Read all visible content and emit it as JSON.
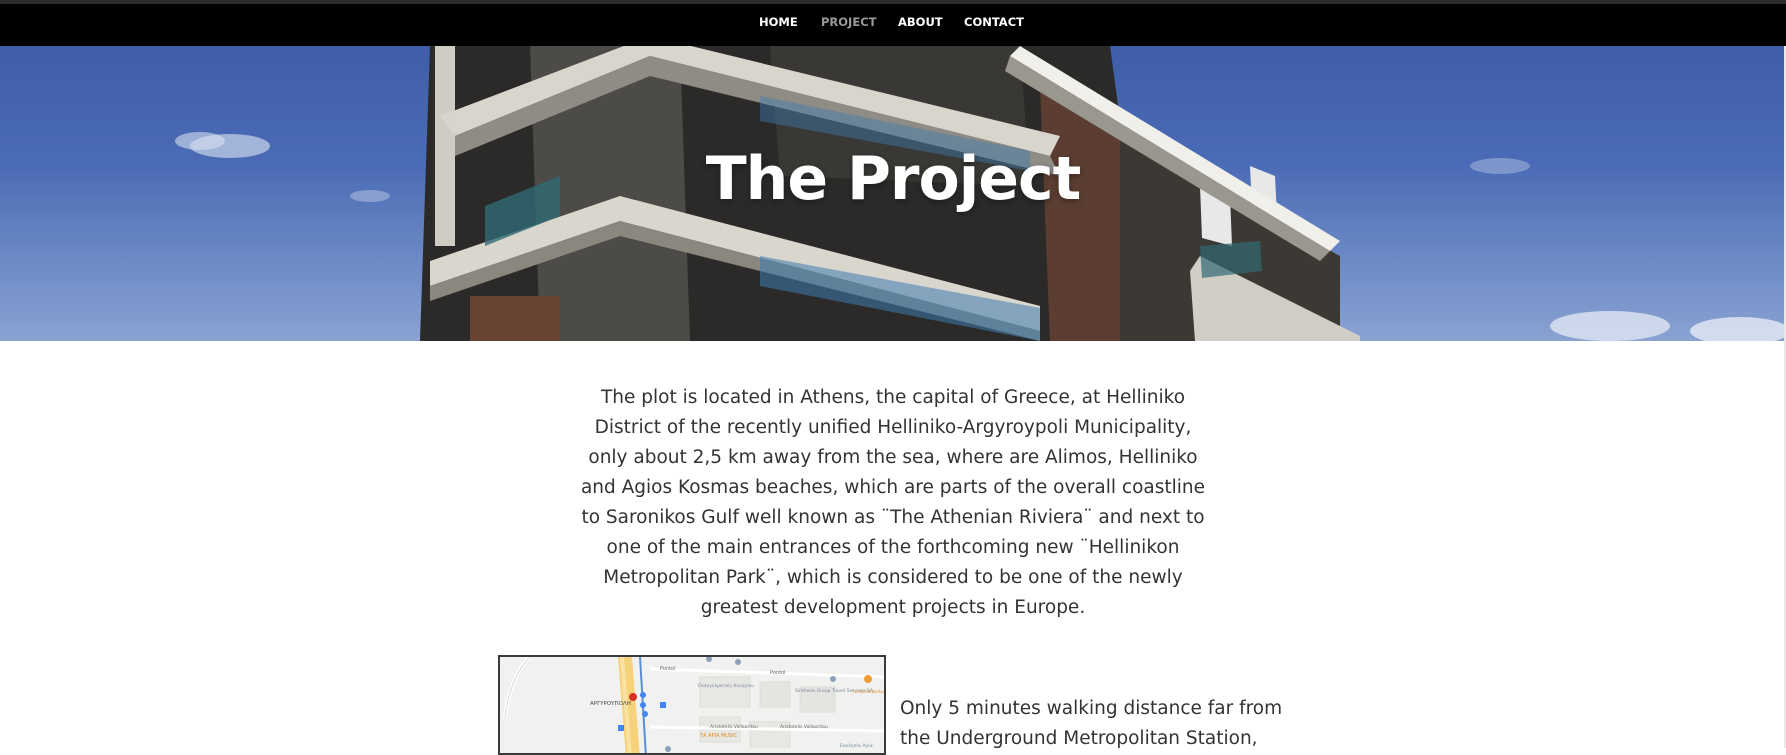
{
  "nav": {
    "items": [
      {
        "label": "HOME",
        "active": false
      },
      {
        "label": "PROJECT",
        "active": true
      },
      {
        "label": "ABOUT",
        "active": false
      },
      {
        "label": "CONTACT",
        "active": false
      }
    ]
  },
  "hero": {
    "title": "The Project"
  },
  "intro": {
    "text": "The plot is located in Athens, the capital of Greece, at Helliniko District of the recently unified Helliniko-Argyroypoli Municipality, only about 2,5 km away from the sea, where are Alimos, Helliniko and Agios Kosmas beaches, which are parts of the overall coastline to Saronikos Gulf well known as ¨The Athenian Riviera¨ and next to one of the main entrances of the forthcoming new ¨Hellinikon Metropolitan Park¨, which is considered to be one of the newly greatest development projects in Europe."
  },
  "map": {
    "labels": {
      "district": "ΑΡΓΥΡΟΥΠΟΛΗ",
      "street1": "Pontol",
      "street2": "Pontol",
      "poi1": "Επαγγελματίες Κυνηγίου",
      "poi2": "Sinthesis Group Travel Services SA",
      "poi3": "Το Κοτόπουλο",
      "poi4": "ΤΑ ΑΡΙΑ MUSIC",
      "street3": "Aristotelis Vallaoritou",
      "street4": "Aristotelis Vallaoritou",
      "poi5": "Εκκλησία Αγία"
    }
  },
  "side": {
    "text": "Only 5 minutes walking distance far from the Underground Metropolitan Station,"
  },
  "colors": {
    "topbar": "#000000",
    "nav_active": "#9a9a9a",
    "nav_text": "#ffffff",
    "body_text": "#333333"
  }
}
